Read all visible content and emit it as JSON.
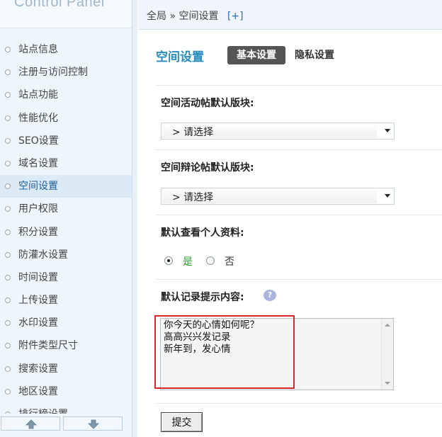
{
  "sidebar": {
    "logo": "Control Panel",
    "items": [
      {
        "label": "站点信息"
      },
      {
        "label": "注册与访问控制"
      },
      {
        "label": "站点功能"
      },
      {
        "label": "性能优化"
      },
      {
        "label": "SEO设置"
      },
      {
        "label": "域名设置"
      },
      {
        "label": "空间设置",
        "active": true
      },
      {
        "label": "用户权限"
      },
      {
        "label": "积分设置"
      },
      {
        "label": "防灌水设置"
      },
      {
        "label": "时间设置"
      },
      {
        "label": "上传设置"
      },
      {
        "label": "水印设置"
      },
      {
        "label": "附件类型尺寸"
      },
      {
        "label": "搜索设置"
      },
      {
        "label": "地区设置"
      },
      {
        "label": "排行榜设置"
      }
    ]
  },
  "breadcrumb": {
    "root": "全局",
    "separator": "»",
    "current": "空间设置",
    "add": "[+]"
  },
  "header": {
    "title": "空间设置",
    "tabs": [
      {
        "label": "基本设置",
        "active": true
      },
      {
        "label": "隐私设置",
        "active": false
      }
    ]
  },
  "form": {
    "activity_forum_label": "空间活动帖默认版块:",
    "activity_forum_value": "> 请选择",
    "debate_forum_label": "空间辩论帖默认版块:",
    "debate_forum_value": "> 请选择",
    "profile_label": "默认查看个人资料:",
    "profile_yes": "是",
    "profile_no": "否",
    "profile_selected": "是",
    "record_label": "默认记录提示内容:",
    "record_value": "你今天的心情如何呢？\n高高兴兴发记录\n新年到，发心情",
    "submit_label": "提交"
  },
  "colors": {
    "title": "#2a8bbf",
    "tab_active_bg": "#555555",
    "highlight": "#d9262b",
    "yes_label": "#2e9a2e"
  }
}
